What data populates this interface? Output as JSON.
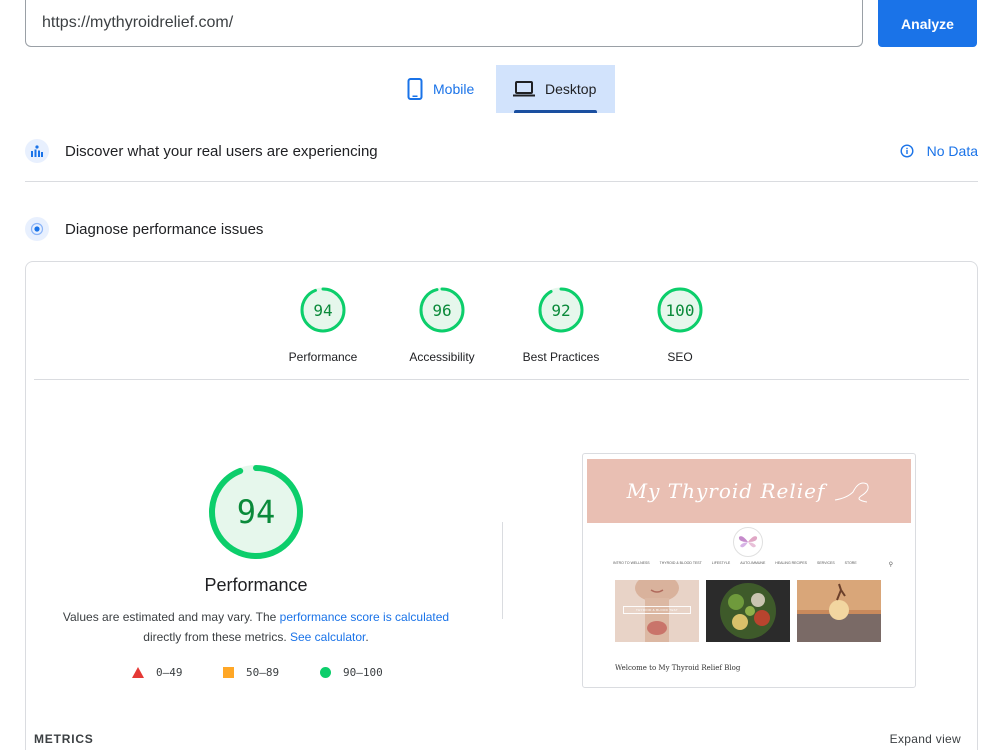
{
  "search": {
    "url_value": "https://mythyroidrelief.com/",
    "analyze_label": "Analyze"
  },
  "tabs": [
    {
      "label": "Mobile",
      "icon": "phone-icon",
      "selected": false
    },
    {
      "label": "Desktop",
      "icon": "laptop-icon",
      "selected": true
    }
  ],
  "field_data": {
    "title": "Discover what your real users are experiencing",
    "status": "No Data",
    "icon": "field-data-icon"
  },
  "lab_data": {
    "title": "Diagnose performance issues",
    "icon": "lab-data-icon"
  },
  "scores": [
    {
      "label": "Performance",
      "value": 94
    },
    {
      "label": "Accessibility",
      "value": 96
    },
    {
      "label": "Best Practices",
      "value": 92
    },
    {
      "label": "SEO",
      "value": 100
    }
  ],
  "performance": {
    "score": 94,
    "title": "Performance",
    "note_prefix": "Values are estimated and may vary. The ",
    "note_link1": "performance score is calculated",
    "note_middle": "directly from these metrics. ",
    "note_link2": "See calculator",
    "note_suffix": "."
  },
  "legend": [
    {
      "range": "0–49",
      "shape": "triangle",
      "color": "#e53935"
    },
    {
      "range": "50–89",
      "shape": "square",
      "color": "#ffa726"
    },
    {
      "range": "90–100",
      "shape": "circle",
      "color": "#0cce6b"
    }
  ],
  "preview": {
    "site_title": "My Thyroid Relief",
    "nav_items": [
      "INTRO TO WELLNESS",
      "THYROID & BLOOD TEST",
      "LIFESTYLE",
      "AUTO-IMMUNE",
      "HEALING RECIPES",
      "SERVICES",
      "STORE"
    ],
    "thumb_button": "THYROID & BLOOD TEST",
    "welcome": "Welcome to My Thyroid Relief Blog"
  },
  "colors": {
    "accent": "#1a73e8",
    "pass": "#0cce6b",
    "pass_text": "#0a8a3a",
    "desktop_tab_bg": "#d2e3fc",
    "banner": "#e9bfb3"
  },
  "metrics": {
    "label": "METRICS",
    "expand": "Expand view"
  }
}
